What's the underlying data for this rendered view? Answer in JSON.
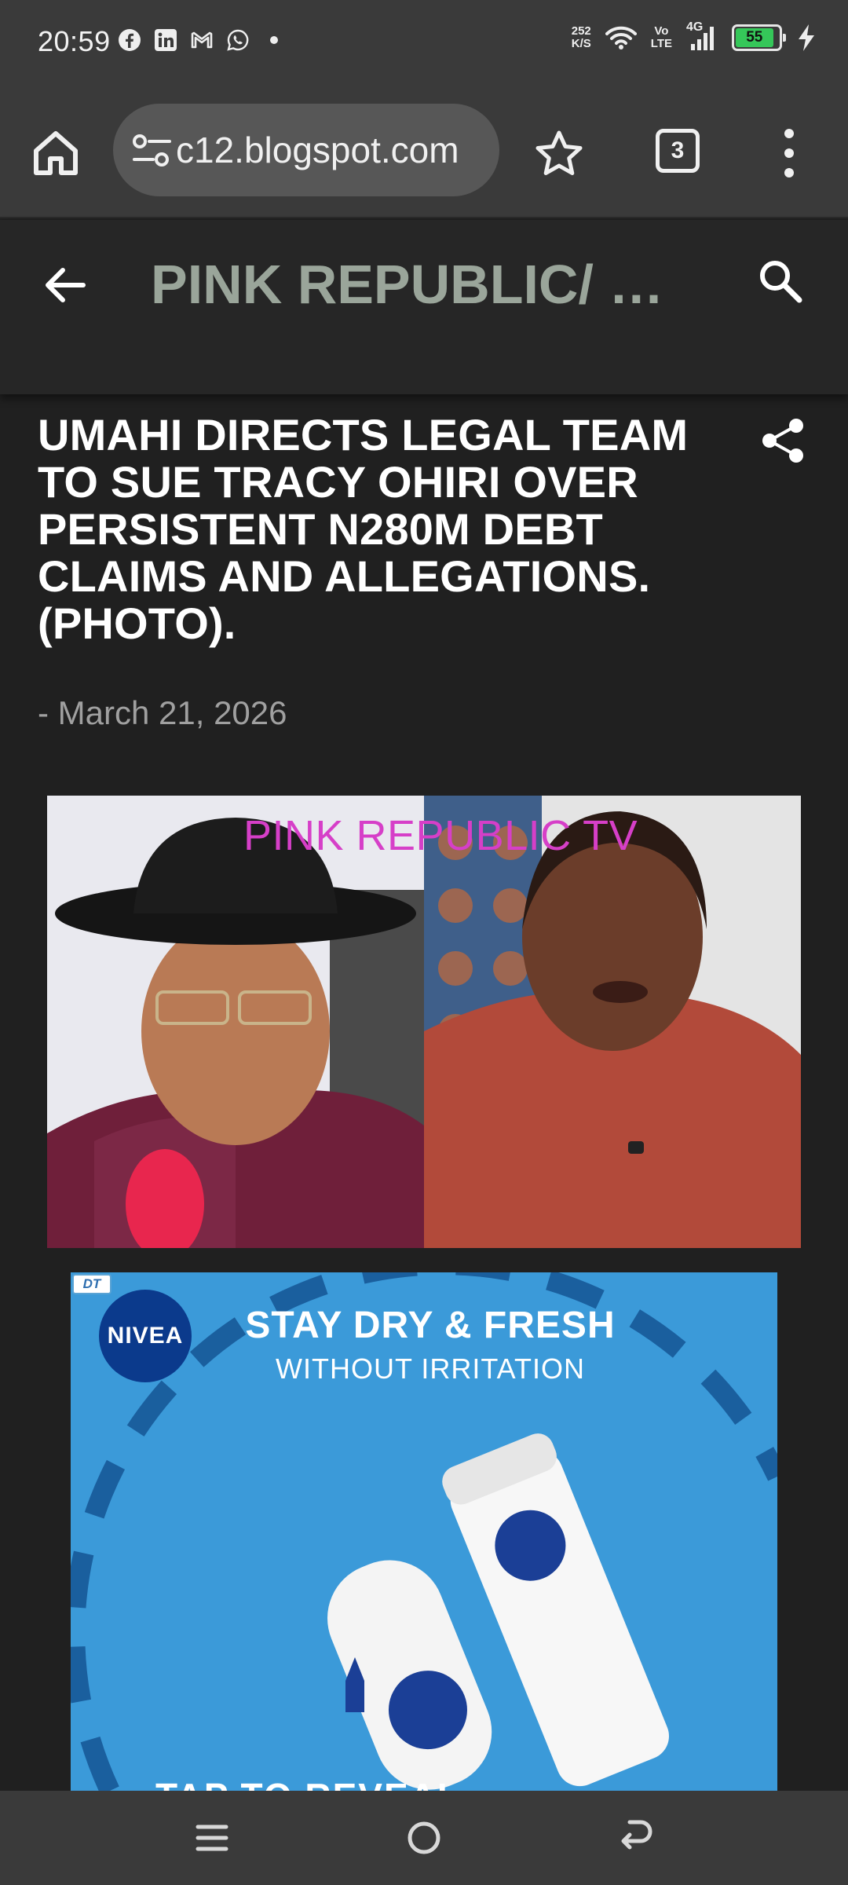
{
  "status_bar": {
    "time": "20:59",
    "notifications": [
      "facebook-icon",
      "linkedin-icon",
      "gmail-icon",
      "whatsapp-icon",
      "dot-icon"
    ],
    "net_speed_value": "252",
    "net_speed_unit": "K/S",
    "volte_top": "Vo",
    "volte_bottom": "LTE",
    "network": "4G",
    "battery": "55"
  },
  "browser": {
    "url": "c12.blogspot.com",
    "tab_count": "3"
  },
  "blog": {
    "title": "PINK REPUBLIC/ M..."
  },
  "article": {
    "title": "UMAHI DIRECTS LEGAL TEAM TO SUE TRACY OHIRI OVER PERSISTENT N280M DEBT CLAIMS AND ALLEGATIONS. (PHOTO).",
    "date": "- March 21, 2026",
    "photo_caption": "PINK REPUBLIC TV"
  },
  "ad": {
    "badge": "DT",
    "brand": "NIVEA",
    "headline": "STAY DRY & FRESH",
    "subheadline": "WITHOUT IRRITATION",
    "cta": "TAP TO REVEAL",
    "colors": {
      "background": "#3b9ad9",
      "brand_blue": "#0b3a8c"
    }
  },
  "colors": {
    "page_bg": "#202020",
    "chrome_bg": "#3a3a3a",
    "blog_title": "#9aa59a",
    "caption_pink": "#d63fc8"
  }
}
